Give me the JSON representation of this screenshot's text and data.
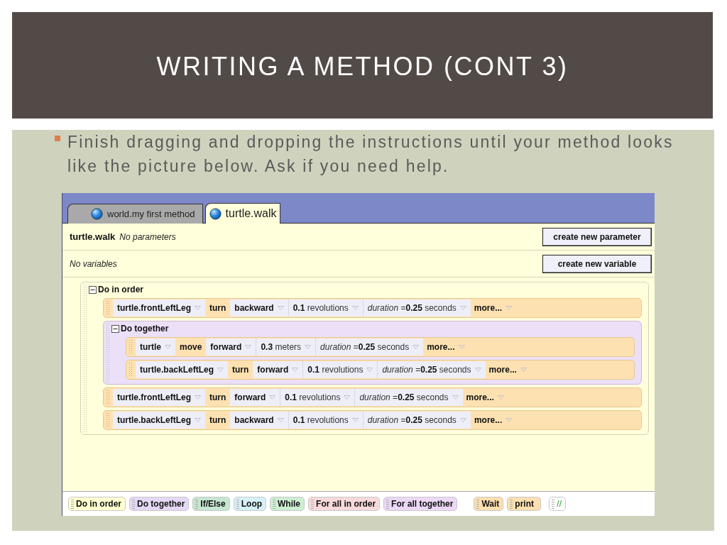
{
  "slide": {
    "title": "WRITING A METHOD (CONT 3)",
    "bullets": [
      "Finish dragging and dropping the instructions until your method looks like the picture below. Ask if you need help."
    ]
  },
  "editor": {
    "tabs": [
      {
        "label": "world.my first method",
        "selected": false
      },
      {
        "label": "turtle.walk",
        "selected": true
      }
    ],
    "method_name": "turtle.walk",
    "parameters_note": "No parameters",
    "parameter_button": "create new parameter",
    "variables_note": "No variables",
    "variable_button": "create new variable",
    "block": {
      "label": "Do in order",
      "expanded": true,
      "statements": [
        {
          "kind": "statement",
          "object": "turtle.frontLeftLeg",
          "verb": "turn",
          "direction": "backward",
          "amount": "**0.1** revolutions",
          "duration": "*duration* =**0.25** seconds",
          "more": "more..."
        },
        {
          "kind": "group",
          "label": "Do together",
          "expanded": true,
          "statements": [
            {
              "kind": "statement",
              "object": "turtle",
              "verb": "move",
              "direction": "forward",
              "amount": "**0.3** meters",
              "duration": "*duration* =**0.25** seconds",
              "more": "more..."
            },
            {
              "kind": "statement",
              "object": "turtle.backLeftLeg",
              "verb": "turn",
              "direction": "forward",
              "amount": "**0.1** revolutions",
              "duration": "*duration* =**0.25** seconds",
              "more": "more..."
            }
          ]
        },
        {
          "kind": "statement",
          "object": "turtle.frontLeftLeg",
          "verb": "turn",
          "direction": "forward",
          "amount": "**0.1** revolutions",
          "duration": "*duration* =**0.25** seconds",
          "more": "more..."
        },
        {
          "kind": "statement",
          "object": "turtle.backLeftLeg",
          "verb": "turn",
          "direction": "backward",
          "amount": "**0.1** revolutions",
          "duration": "*duration* =**0.25** seconds",
          "more": "more..."
        }
      ]
    },
    "palette": [
      {
        "label": "Do in order",
        "kind": "control",
        "color": "#ffffd0"
      },
      {
        "label": "Do together",
        "kind": "control",
        "color": "#e4d8f6"
      },
      {
        "label": "If/Else",
        "kind": "control",
        "color": "#c6e6d0"
      },
      {
        "label": "Loop",
        "kind": "control",
        "color": "#d6f0f6"
      },
      {
        "label": "While",
        "kind": "control",
        "color": "#cdeed2"
      },
      {
        "label": "For all in order",
        "kind": "control",
        "color": "#f8dada"
      },
      {
        "label": "For all together",
        "kind": "control",
        "color": "#ecd8f6"
      },
      {
        "label": "Wait",
        "kind": "statement",
        "color": "#fde0b0"
      },
      {
        "label": "print",
        "kind": "statement",
        "color": "#fde0b0"
      },
      {
        "label": "//",
        "kind": "comment",
        "color": "#ffffff"
      }
    ]
  }
}
